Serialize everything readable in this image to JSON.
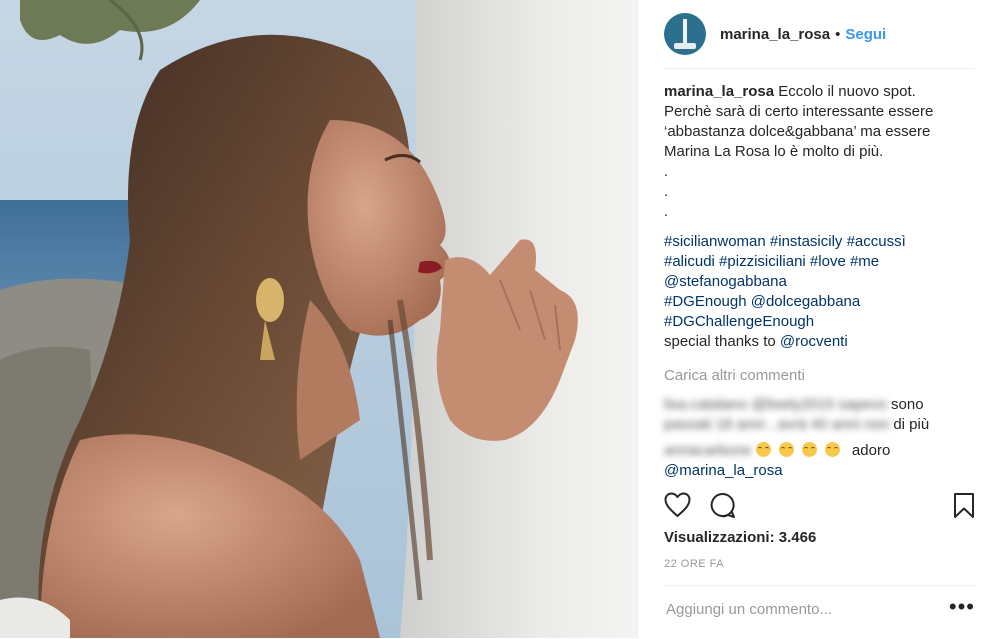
{
  "post": {
    "username": "marina_la_rosa",
    "separator": "•",
    "follow_label": "Segui",
    "caption": {
      "author": "marina_la_rosa",
      "lines": [
        "Eccolo il nuovo spot.",
        "Perchè sarà di certo interessante essere",
        "‘abbastanza dolce&gabbana’ ma essere",
        "Marina La Rosa lo è molto di più.",
        ".",
        ".",
        "."
      ],
      "hashtags_line1": [
        "#sicilianwoman",
        "#instasicily",
        "#accussì"
      ],
      "hashtags_line2": [
        "#alicudi",
        "#pizzisiciliani",
        "#love",
        "#me"
      ],
      "mention1": "@stefanogabbana",
      "hashtags_line3": [
        "#DGEnough",
        "@dolcegabbana"
      ],
      "hashtag4": "#DGChallengeEnough",
      "thanks_text": "special thanks to",
      "thanks_mention": "@rocventi"
    },
    "load_more_label": "Carica altri commenti",
    "comment1": {
      "blurred_line1": "lisa.catalano @lisety2015 sapevo",
      "visible_tail1": "sono",
      "blurred_line2": "passati 18 anni , avrà 40 anni non",
      "visible_tail2": "di più"
    },
    "comment2": {
      "blurred_author": "annacarbone",
      "text": "adoro",
      "mention": "@marina_la_rosa"
    },
    "views_label": "Visualizzazioni: 3.466",
    "time_ago": "22 ORE FA",
    "add_comment_placeholder": "Aggiungi un commento...",
    "more_label": "•••"
  },
  "icons": {
    "like": "heart-outline-icon",
    "comment": "speech-bubble-icon",
    "save": "bookmark-outline-icon",
    "more": "more-dots-icon"
  },
  "colors": {
    "link": "#3897f0",
    "hashtag": "#003569",
    "muted": "#999999",
    "text": "#262626"
  }
}
